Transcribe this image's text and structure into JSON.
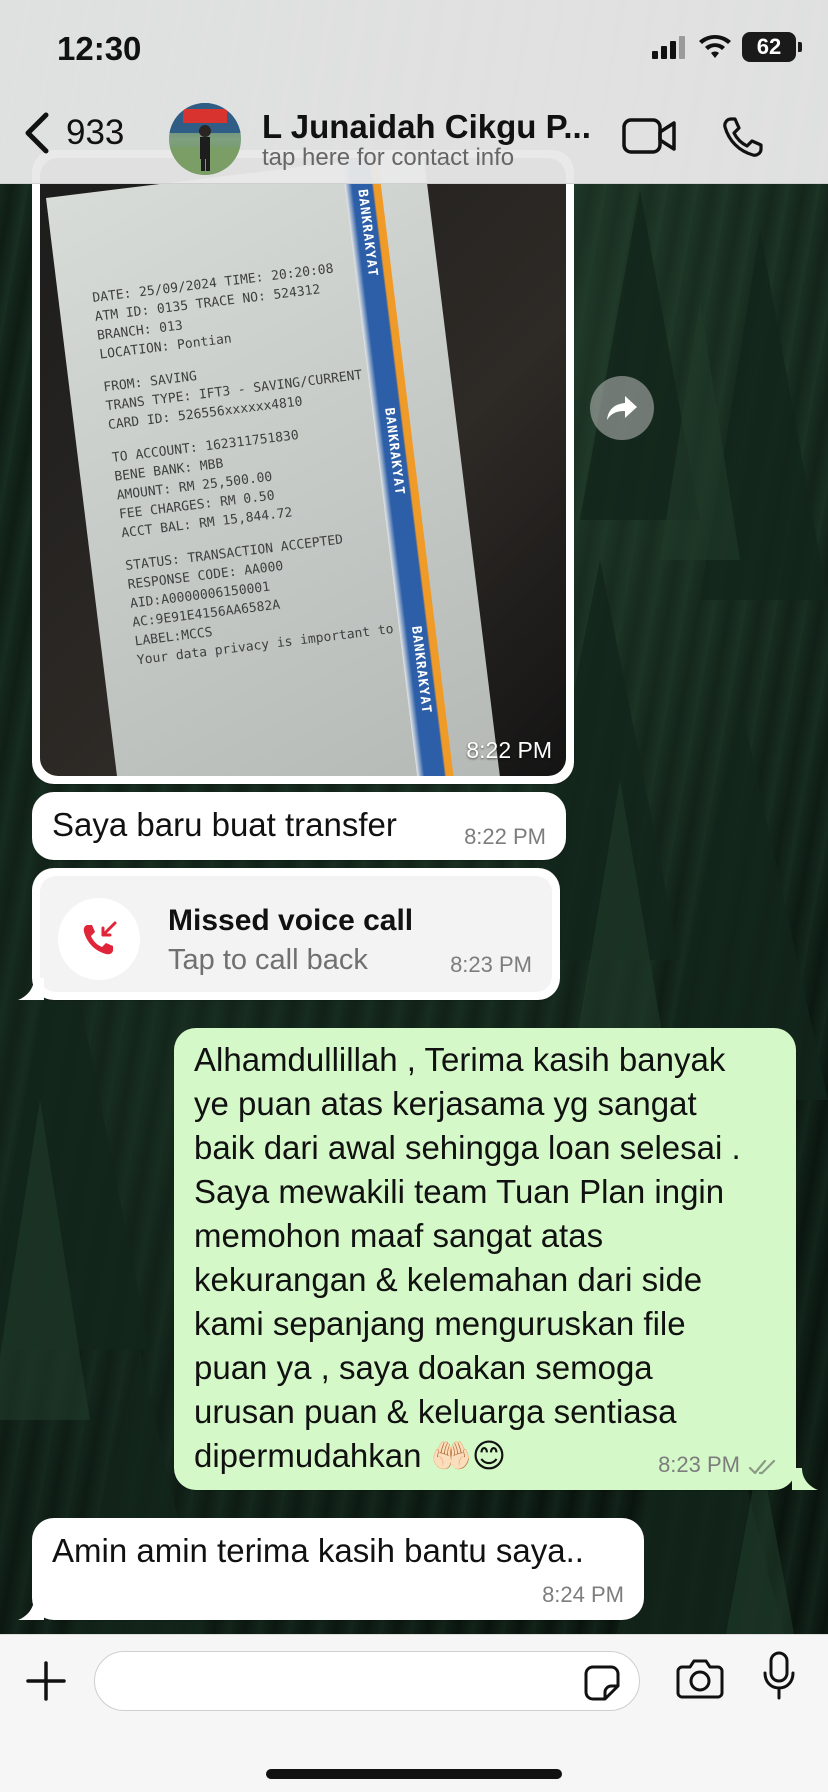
{
  "status_bar": {
    "time": "12:30",
    "battery": "62"
  },
  "header": {
    "back_count": "933",
    "contact_name": "L Junaidah Cikgu P...",
    "subtitle": "tap here for contact info"
  },
  "messages": {
    "photo": {
      "time": "8:22 PM",
      "receipt_lines": [
        "DATE: 25/09/2024 TIME: 20:20:08",
        "ATM ID: 0135      TRACE NO: 524312",
        "BRANCH: 013",
        "LOCATION: Pontian",
        "FROM: SAVING",
        "TRANS TYPE: IFT3 - SAVING/CURRENT",
        "CARD ID: 526556xxxxxx4810",
        "TO ACCOUNT: 162311751830",
        "BENE BANK: MBB",
        "AMOUNT: RM 25,500.00",
        "FEE CHARGES: RM 0.50",
        "ACCT BAL: RM 15,844.72",
        "STATUS: TRANSACTION ACCEPTED",
        "RESPONSE CODE: AA000",
        "AID:A0000006150001",
        "AC:9E91E4156AA6582A",
        "LABEL:MCCS",
        "Your data privacy is important to us"
      ],
      "brand": "BANKRAKYAT"
    },
    "transfer": {
      "text": "Saya baru buat transfer",
      "time": "8:22 PM"
    },
    "missed_call": {
      "title": "Missed voice call",
      "subtitle": "Tap to call back",
      "time": "8:23 PM"
    },
    "outgoing": {
      "lines": [
        "Alhamdullillah , Terima kasih banyak",
        "ye puan atas kerjasama yg sangat",
        "baik dari awal sehingga loan selesai .",
        "Saya mewakili team Tuan Plan ingin",
        "memohon maaf sangat atas",
        "kekurangan & kelemahan dari side",
        "kami sepanjang menguruskan file",
        "puan ya , saya doakan semoga",
        "urusan puan & keluarga sentiasa",
        "dipermudahkan 🤲🏻😊"
      ],
      "time": "8:23 PM"
    },
    "reply": {
      "text": "Amin amin terima kasih bantu saya..",
      "time": "8:24 PM"
    }
  },
  "input": {
    "placeholder": ""
  },
  "icons": {
    "back": "chevron-left-icon",
    "video": "video-camera-icon",
    "call": "phone-icon",
    "forward": "forward-icon",
    "missed_call": "missed-call-icon",
    "read": "double-check-icon",
    "add": "plus-icon",
    "sticker": "sticker-icon",
    "camera": "camera-icon",
    "mic": "microphone-icon"
  },
  "colors": {
    "outgoing_bubble": "#d4f8c7",
    "incoming_bubble": "#ffffff",
    "missed_call_red": "#e0253a",
    "header_bg": "#e8e8e8"
  }
}
